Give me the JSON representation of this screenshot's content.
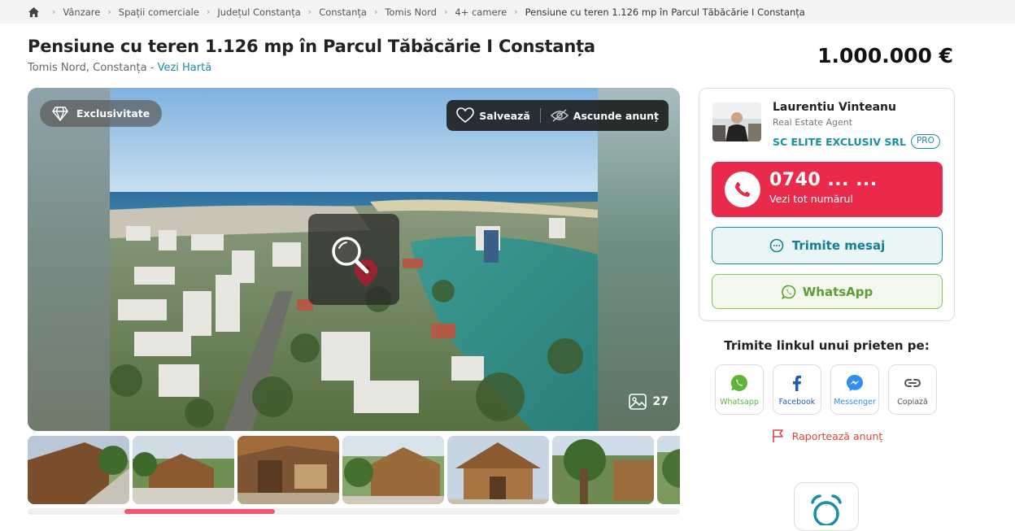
{
  "breadcrumb": {
    "home_icon": "home-icon",
    "items": [
      "Vânzare",
      "Spații comerciale",
      "Județul Constanța",
      "Constanța",
      "Tomis Nord",
      "4+ camere",
      "Pensiune cu teren 1.126 mp în Parcul Tăbăcărie I Constanța"
    ]
  },
  "listing": {
    "title": "Pensiune cu teren 1.126 mp în Parcul Tăbăcărie I Constanța",
    "location": "Tomis Nord, Constanța",
    "location_sep": " - ",
    "map_link": "Vezi Hartă",
    "price": "1.000.000 €"
  },
  "gallery": {
    "exclusive_label": "Exclusivitate",
    "save_label": "Salvează",
    "hide_label": "Ascunde anunț",
    "photo_count": "27",
    "thumbnail_count": 7,
    "scroll_position": 0.18
  },
  "agent": {
    "name": "Laurentiu Vinteanu",
    "role": "Real Estate Agent",
    "company": "SC ELITE EXCLUSIV SRL",
    "pro_badge": "PRO",
    "phone": "0740 ... ...",
    "phone_sub": "Vezi tot numărul",
    "message_label": "Trimite mesaj",
    "whatsapp_label": "WhatsApp"
  },
  "share": {
    "title": "Trimite linkul unui prieten pe:",
    "items": [
      {
        "label": "Whatsapp",
        "icon": "whatsapp-icon",
        "color": "#5fb33a"
      },
      {
        "label": "Facebook",
        "icon": "facebook-icon",
        "color": "#1d5fa8"
      },
      {
        "label": "Messenger",
        "icon": "messenger-icon",
        "color": "#2f8ef0"
      },
      {
        "label": "Copiază",
        "icon": "link-icon",
        "color": "#555555"
      }
    ],
    "report_label": "Raportează anunț"
  },
  "colors": {
    "accent": "#1a8fa0",
    "phone_red": "#ea2a4a",
    "whatsapp_green": "#5f9e34",
    "scroll_pink": "#ee5a74"
  }
}
